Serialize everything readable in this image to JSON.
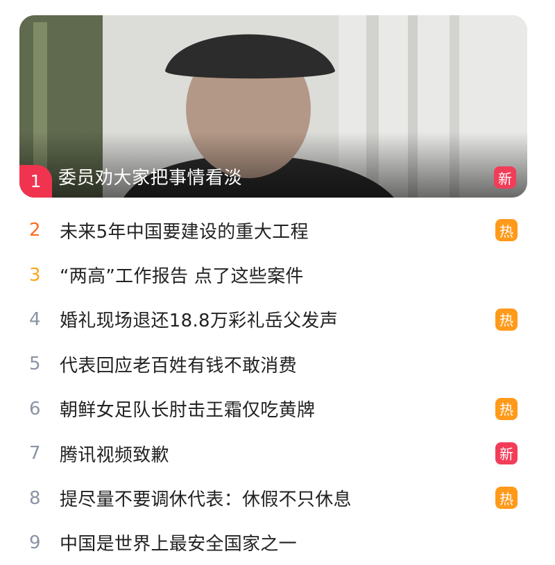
{
  "featured": {
    "rank": "1",
    "title": "委员劝大家把事情看淡",
    "tag": "新"
  },
  "items": [
    {
      "rank": "2",
      "title": "未来5年中国要建设的重大工程",
      "tag": "热"
    },
    {
      "rank": "3",
      "title": "“两高”工作报告 点了这些案件",
      "tag": ""
    },
    {
      "rank": "4",
      "title": "婚礼现场退还18.8万彩礼岳父发声",
      "tag": "热"
    },
    {
      "rank": "5",
      "title": "代表回应老百姓有钱不敢消费",
      "tag": ""
    },
    {
      "rank": "6",
      "title": "朝鲜女足队长肘击王霜仅吃黄牌",
      "tag": "热"
    },
    {
      "rank": "7",
      "title": "腾讯视频致歉",
      "tag": "新"
    },
    {
      "rank": "8",
      "title": "提尽量不要调休代表：休假不只休息",
      "tag": "热"
    },
    {
      "rank": "9",
      "title": "中国是世界上最安全国家之一",
      "tag": ""
    }
  ],
  "colors": {
    "new_tag": "#f23d59",
    "hot_tag": "#ff9a1a",
    "rank_1": "#f0344f",
    "rank_2": "#ff6a1f",
    "rank_3": "#ffa41d",
    "rank_other": "#8b93a5"
  }
}
